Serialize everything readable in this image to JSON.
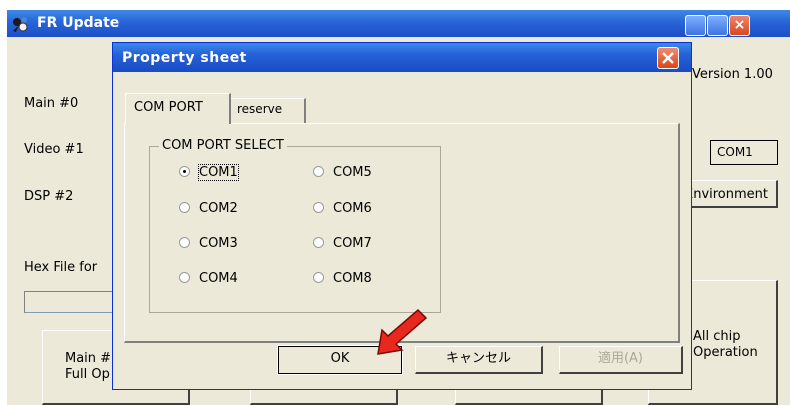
{
  "main_window": {
    "title": "FR Update",
    "version": "Version 1.00",
    "labels": {
      "main": "Main #0",
      "video": "Video #1",
      "dsp": "DSP #2",
      "hex_file": "Hex File for"
    },
    "com_value": "COM1",
    "environment_button": "Environment",
    "buttons": {
      "main_full_line1": "Main #",
      "main_full_line2": "Full Op",
      "all_chip_line1": "All chip",
      "all_chip_line2": "Operation"
    }
  },
  "dialog": {
    "title": "Property sheet",
    "tabs": [
      {
        "label": "COM PORT",
        "active": true
      },
      {
        "label": "reserve",
        "active": false
      }
    ],
    "group_title": "COM PORT SELECT",
    "ports": [
      {
        "label": "COM1",
        "checked": true
      },
      {
        "label": "COM2",
        "checked": false
      },
      {
        "label": "COM3",
        "checked": false
      },
      {
        "label": "COM4",
        "checked": false
      },
      {
        "label": "COM5",
        "checked": false
      },
      {
        "label": "COM6",
        "checked": false
      },
      {
        "label": "COM7",
        "checked": false
      },
      {
        "label": "COM8",
        "checked": false
      }
    ],
    "buttons": {
      "ok": "OK",
      "cancel": "キャンセル",
      "apply": "適用(A)"
    }
  },
  "colors": {
    "titlebar": "#2a64d8",
    "dialog_face": "#ece9d8",
    "close_red": "#d9461c",
    "pointer_arrow": "#e8281e"
  },
  "icons": [
    "app-icon",
    "minimize-icon",
    "maximize-icon",
    "close-icon",
    "pointer-arrow-icon"
  ]
}
